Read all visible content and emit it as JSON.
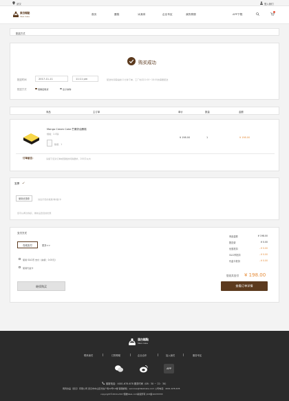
{
  "topbar": {
    "location": "武汉",
    "login": "登入我们"
  },
  "logo": {
    "cn": "蛋白糕點",
    "en": "S&G Cake"
  },
  "nav": {
    "items": [
      "首页",
      "蛋糕",
      "冰淇淋",
      "企业专区",
      "我的褒弱"
    ],
    "app": "APP下载"
  },
  "delivery_title": "配送方式",
  "success": {
    "title": "购买成功",
    "date_label": "配送时间",
    "date_value": "2017-11-11",
    "time_value": "11:11 pm",
    "date_note": "配送时间需提前11分钟下单，工厂时间11:00~18:00的需要配送",
    "method_label": "配送方式",
    "method_options": [
      "蛋糕店取货",
      "出子快购"
    ]
  },
  "table": {
    "headers": [
      "商品",
      "主订单",
      "单价",
      "数量",
      "金额"
    ],
    "product": {
      "name": "Mango Cream Cake 芒果奶油蛋糕",
      "spec": "规格：2.0磅",
      "qty_note": "数量：1",
      "price": "¥ 198.00",
      "qty": "1",
      "amount": "¥ 198.00"
    },
    "remark_label": "订单留言：",
    "remark_text": "请留下您对订单或蛋糕的特殊要求，200字以内"
  },
  "invoice": {
    "label": "发票",
    "button": "使用优惠券",
    "placeholder": "请出示您的发票/券/章/卡",
    "note": "您可以再次购买，重新设置您的优惠"
  },
  "payment": {
    "label": "支付方式",
    "online": "在线支付",
    "more": "更多>>",
    "opt1": "使用 S&G币 支付（余额：0.00元）",
    "opt2": "使用代金卡",
    "continue": "继续购买",
    "summary": [
      {
        "k": "商品金额",
        "v": "¥ 198.00"
      },
      {
        "k": "配送费",
        "v": "¥ 0.00"
      },
      {
        "k": "优惠抵扣",
        "v": "- ¥ 0.00"
      },
      {
        "k": "S&G币抵扣",
        "v": "- ¥ 0.00"
      },
      {
        "k": "代金卡抵扣",
        "v": "- ¥ 0.00"
      }
    ],
    "total_label": "您总共支付",
    "total_value": "¥ 198.00",
    "view_button": "查看订单详情"
  },
  "footer": {
    "logo_cn": "蛋白糕點",
    "logo_en": "S&G Cake",
    "links": [
      "联系我们",
      "订购帮助",
      "企业合作",
      "加入我们",
      "服务专区"
    ],
    "app": "APP",
    "contact": "客服电话：4001-678-678  服务时间（08：30 － 22：30）",
    "company": "雨周食品（武汉）有限公司 武汉市中山区光谷广场22号13楼 客服邮箱：services@S&GCake.com 公司电话：4001-678-678",
    "copyright": "copyright©2010-2017蛋糕S&G.com版权所有 |ICP备10233333"
  }
}
